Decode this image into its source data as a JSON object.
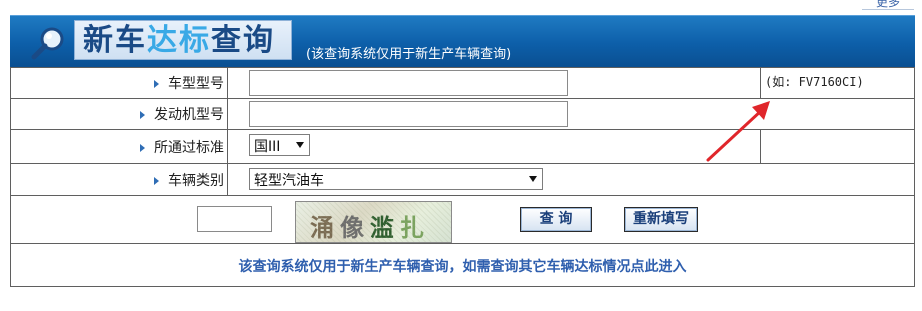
{
  "top_link": "更多",
  "header": {
    "title_part1": "新车",
    "title_highlight": "达标",
    "title_part2": "查询",
    "subtitle": "(该查询系统仅用于新生产车辆查询)"
  },
  "form": {
    "vehicle_model": {
      "label": "车型型号",
      "value": "",
      "hint": "(如: FV7160CI)"
    },
    "engine_model": {
      "label": "发动机型号",
      "value": ""
    },
    "standard": {
      "label": "所通过标准",
      "selected": "国III"
    },
    "vehicle_type": {
      "label": "车辆类别",
      "selected": "轻型汽油车"
    },
    "captcha": {
      "code_value": "",
      "image_text": [
        "涌",
        "像",
        "滥",
        "扎"
      ]
    },
    "buttons": {
      "query": "查 询",
      "reset": "重新填写"
    },
    "notice": "该查询系统仅用于新生产车辆查询，如需查询其它车辆达标情况点此进入"
  },
  "colors": {
    "header_blue": "#0d5fa9",
    "title_highlight": "#39a9e6",
    "notice_text": "#2f5fae",
    "arrow_red": "#e0262b"
  }
}
